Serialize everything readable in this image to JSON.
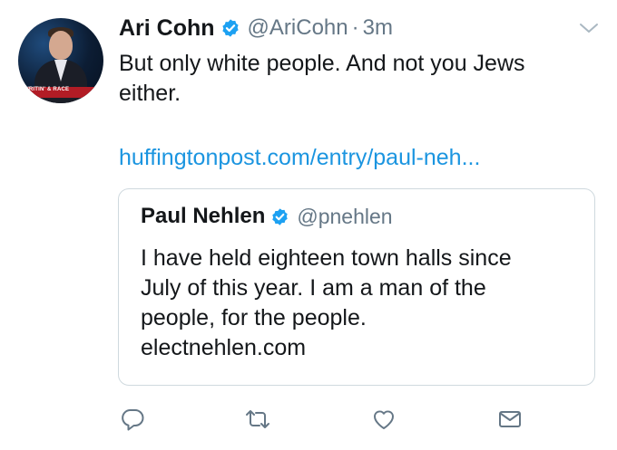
{
  "tweet": {
    "author": {
      "name": "Ari Cohn",
      "handle": "@AriCohn",
      "separator": "·",
      "time": "3m",
      "avatar_banner": "WRITIN' & RACE"
    },
    "text_lines": [
      "But only white people. And not you Jews",
      "either."
    ],
    "link": "huffingtonpost.com/entry/paul-neh...",
    "quoted": {
      "name": "Paul Nehlen",
      "handle": "@pnehlen",
      "text_lines": [
        "I have held eighteen town halls since",
        "July of this year. I am a man of the",
        "people, for the people.",
        "electnehlen.com"
      ]
    },
    "actions": [
      "reply-icon",
      "retweet-icon",
      "like-icon",
      "message-icon"
    ],
    "colors": {
      "text": "#14171a",
      "secondary": "#657786",
      "link": "#1b95e0",
      "verified": "#1da1f2",
      "border": "#cfd9de",
      "icon": "#657786"
    }
  }
}
